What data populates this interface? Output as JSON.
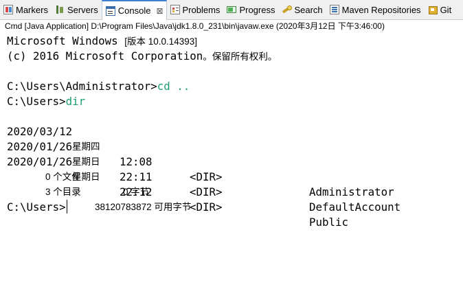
{
  "tabs": [
    {
      "label": "Markers",
      "icon": "markers-icon"
    },
    {
      "label": "Servers",
      "icon": "servers-icon"
    },
    {
      "label": "Console",
      "icon": "console-icon",
      "active": true,
      "close": "⊠"
    },
    {
      "label": "Problems",
      "icon": "problems-icon"
    },
    {
      "label": "Progress",
      "icon": "progress-icon"
    },
    {
      "label": "Search",
      "icon": "search-icon"
    },
    {
      "label": "Maven Repositories",
      "icon": "maven-icon"
    },
    {
      "label": "Git",
      "icon": "git-icon"
    }
  ],
  "console_title": "Cmd [Java Application] D:\\Program Files\\Java\\jdk1.8.0_231\\bin\\javaw.exe (2020年3月12日 下午3:46:00)",
  "console": {
    "banner": {
      "line1_a": "Microsoft Windows ",
      "line1_b": "[版本 10.0.14393]",
      "line2_a": "(c) 2016 Microsoft Corporation",
      "line2_b": "。保留所有权利。"
    },
    "cmd1": {
      "prompt": "C:\\Users\\Administrator>",
      "command": "cd .."
    },
    "cmd2": {
      "prompt": "C:\\Users>",
      "command": "dir"
    },
    "entries": [
      {
        "date": "2020/03/12",
        "weekday": "星期四",
        "time": "12:08",
        "type": "<DIR>",
        "name": "Administrator"
      },
      {
        "date": "2020/01/26",
        "weekday": "星期日",
        "time": "22:11",
        "type": "<DIR>",
        "name": "DefaultAccount"
      },
      {
        "date": "2020/01/26",
        "weekday": "星期日",
        "time": "22:12",
        "type": "<DIR>",
        "name": "Public"
      }
    ],
    "summary_files": {
      "count": "0 个文件",
      "size": "0 字节"
    },
    "summary_dirs": {
      "count": "3 个目录",
      "size": "38120783872 可用字节"
    },
    "final_prompt": "C:\\Users>"
  },
  "colors": {
    "command_text": "#1d9e6e",
    "active_tab_border": "#3b7fd6"
  }
}
